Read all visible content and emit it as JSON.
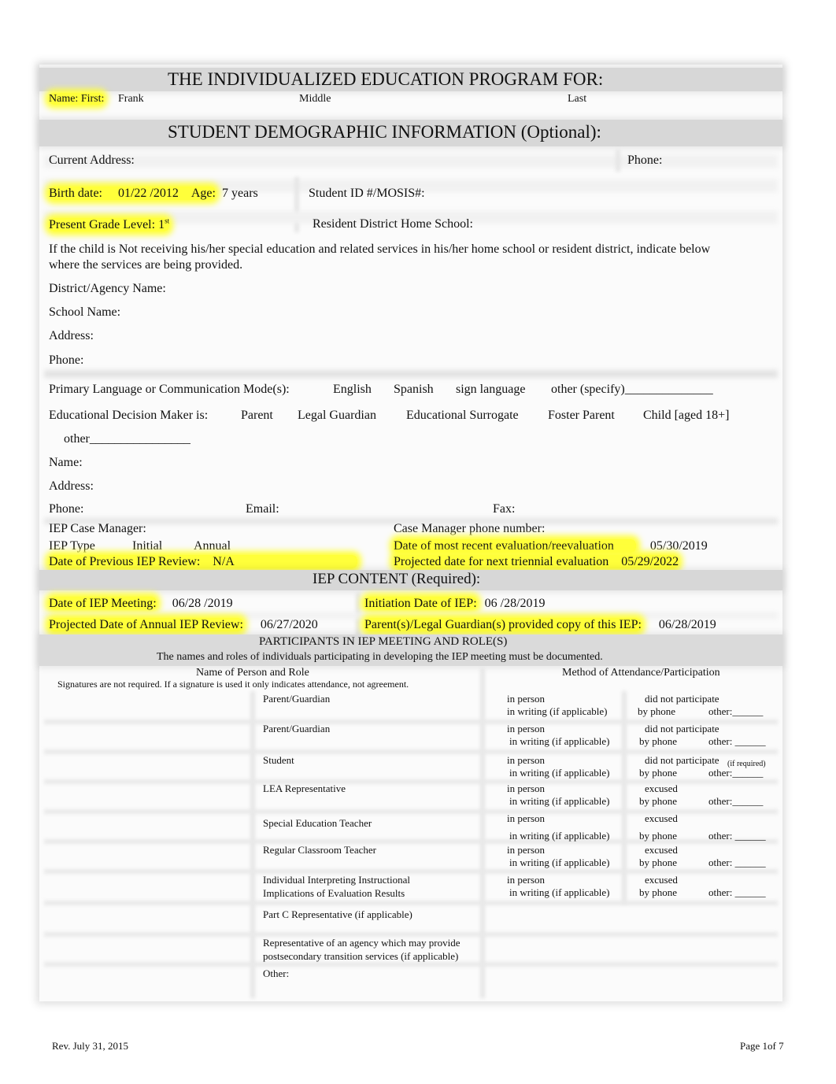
{
  "header": {
    "title": "THE INDIVIDUALIZED EDUCATION PROGRAM FOR:",
    "name_label": "Name: First:",
    "first_name": "Frank",
    "middle_label": "Middle",
    "last_label": "Last"
  },
  "demographic": {
    "title": "STUDENT DEMOGRAPHIC INFORMATION (Optional):",
    "current_address_label": "Current Address:",
    "phone_label": "Phone:",
    "birth_date_label": "Birth date:",
    "birth_date": "01/22 /2012",
    "age_label": "Age:",
    "age": "7 years",
    "student_id_label": "Student ID #/MOSIS#:",
    "grade_label": "Present Grade Level:",
    "grade": "1",
    "grade_suffix": "st",
    "resident_district_label": "Resident District Home School:",
    "not_receiving_text": "If the child is Not receiving his/her special education and related services in his/her home school or resident district, indicate below",
    "not_receiving_text2": "where the services are being provided.",
    "district_agency_label": "District/Agency Name:",
    "school_name_label": "School Name:",
    "address_label": "Address:",
    "phone2_label": "Phone:",
    "primary_language_label": "Primary Language or Communication Mode(s):",
    "language_options": [
      "English",
      "Spanish",
      "sign language",
      "other (specify)______________"
    ],
    "decision_maker_label": "Educational Decision Maker is:",
    "decision_maker_options": [
      "Parent",
      "Legal Guardian",
      "Educational Surrogate",
      "Foster Parent",
      "Child [aged 18+]"
    ],
    "decision_maker_other": "other________________",
    "dm_name_label": "Name:",
    "dm_address_label": "Address:",
    "dm_phone_label": "Phone:",
    "dm_email_label": "Email:",
    "dm_fax_label": "Fax:",
    "case_manager_label": "IEP Case Manager:",
    "case_manager_phone_label": "Case Manager phone number:",
    "iep_type_label": "IEP Type",
    "iep_type_options": [
      "Initial",
      "Annual"
    ],
    "recent_eval_label": "Date of most recent evaluation/reevaluation",
    "recent_eval_date": "05/30/2019",
    "prev_review_label": "Date of Previous IEP Review:",
    "prev_review_value": "N/A",
    "triennial_label": "Projected date for next triennial evaluation",
    "triennial_date": "05/29/2022"
  },
  "iep_content": {
    "title": "IEP CONTENT (Required):",
    "meeting_label": "Date of IEP Meeting:",
    "meeting_date": "06/28 /2019",
    "initiation_label": "Initiation Date of IEP:",
    "initiation_date": "06 /28/2019",
    "annual_review_label": "Projected Date of Annual IEP Review:",
    "annual_review_date": "06/27/2020",
    "copy_label": "Parent(s)/Legal Guardian(s) provided copy of this IEP:",
    "copy_date": "06/28/2019"
  },
  "participants": {
    "title": "PARTICIPANTS IN IEP MEETING AND ROLE(S)",
    "subtitle": "The names and roles of individuals participating in developing    the IEP meeting must be documented.",
    "col_name": "Name of Person and Role",
    "col_method": "Method of Attendance/Participation",
    "signature_note": "Signatures are not required.  If a signature is used it only indicates attendance, not agreement.",
    "rows": [
      {
        "role": "Parent/Guardian",
        "role2": "",
        "m1": "in person",
        "m2": "did not participate",
        "m2note": "",
        "m3": "in writing (if applicable)",
        "m4": "by phone",
        "m5": "other:______"
      },
      {
        "role": "Parent/Guardian",
        "role2": "",
        "m1": "in person",
        "m2": "did not participate",
        "m2note": "",
        "m3": "in writing (if applicable)",
        "m4": "by phone",
        "m5": "other: ______"
      },
      {
        "role": "Student",
        "role2": "",
        "m1": "in person",
        "m2": "did not participate",
        "m2note": "(if required)",
        "m3": "in writing (if applicable)",
        "m4": "by phone",
        "m5": "other:______"
      },
      {
        "role": "LEA Representative",
        "role2": "",
        "m1": "in person",
        "m2": "excused",
        "m2note": "",
        "m3": "in writing (if applicable)",
        "m4": "by phone",
        "m5": "other:______"
      },
      {
        "role": "Special Education Teacher",
        "role2": "",
        "m1": "in person",
        "m2": "excused",
        "m2note": "",
        "m3": "in writing (if applicable)",
        "m4": "by phone",
        "m5": "other: ______"
      },
      {
        "role": "Regular Classroom Teacher",
        "role2": "",
        "m1": "in person",
        "m2": "excused",
        "m2note": "",
        "m3": "in writing (if applicable)",
        "m4": "by phone",
        "m5": "other: ______"
      },
      {
        "role": "Individual Interpreting Instructional",
        "role2": "Implications of Evaluation Results",
        "m1": "in person",
        "m2": "excused",
        "m2note": "",
        "m3": "in writing (if applicable)",
        "m4": "by phone",
        "m5": "other: ______"
      }
    ],
    "extra_roles": [
      {
        "role": "Part C Representative (if applicable)",
        "role2": ""
      },
      {
        "role": "Representative of an agency which may provide",
        "role2": "postsecondary transition services (if applicable)"
      },
      {
        "role": "Other:",
        "role2": ""
      }
    ]
  },
  "footer": {
    "revision": "Rev. July 31, 2015",
    "page": "Page 1of 7"
  }
}
